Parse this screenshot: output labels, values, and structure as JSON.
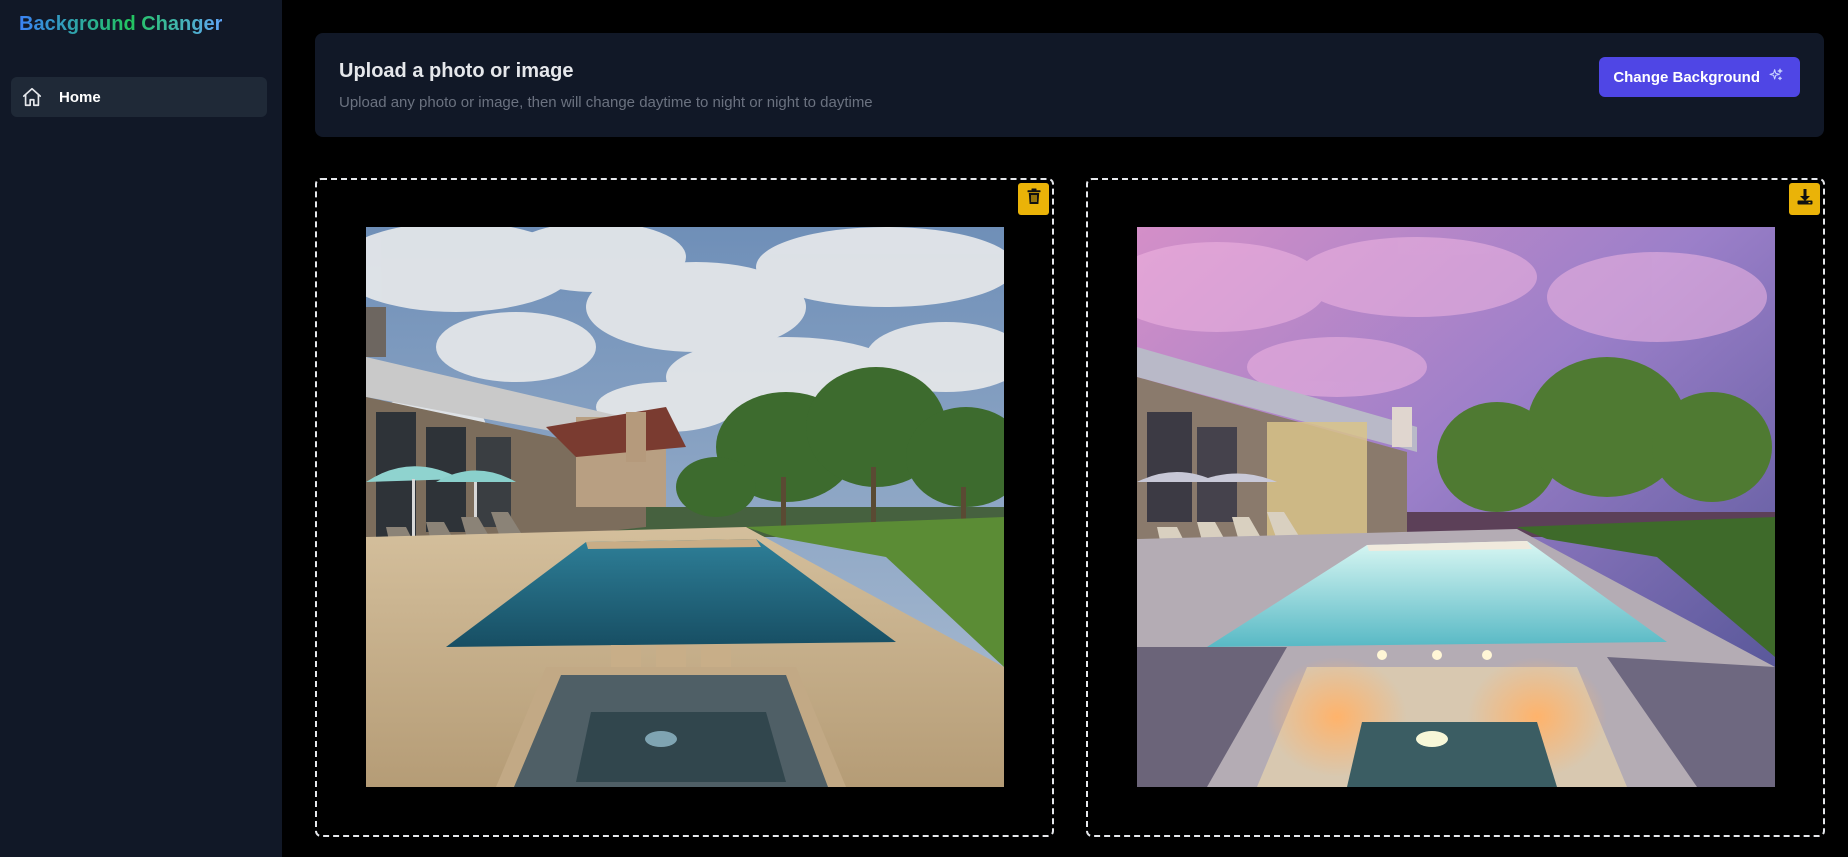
{
  "app": {
    "title": "Background Changer"
  },
  "sidebar": {
    "items": [
      {
        "label": "Home",
        "icon": "home-icon",
        "active": true
      }
    ]
  },
  "upload": {
    "title": "Upload a photo or image",
    "subtitle": "Upload any photo or image, then will change daytime to night or night to daytime",
    "button_label": "Change Background",
    "button_icon": "sparkles-icon"
  },
  "panels": {
    "original": {
      "action_icon": "trash-icon",
      "image": "original-pool-daytime-photo"
    },
    "result": {
      "action_icon": "download-icon",
      "image": "generated-pool-dusk-photo"
    }
  },
  "colors": {
    "sidebar_bg": "#111827",
    "card_bg": "#111827",
    "accent": "#4f46e5",
    "action_yellow": "#eab308"
  }
}
